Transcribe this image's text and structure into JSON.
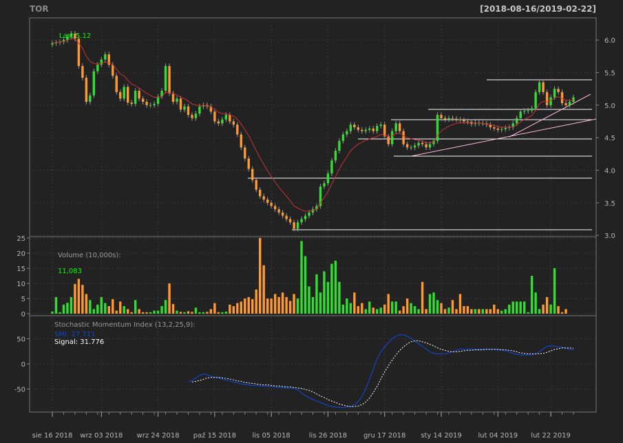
{
  "chart_data": {
    "type": "candlestick",
    "title": "TOR",
    "date_range": "[2018-08-16/2019-02-22]",
    "colors": {
      "background": "#222222",
      "grid": "#3a3a3a",
      "up": "#33dd33",
      "down": "#ff9933",
      "ma": "#cc3333",
      "smi": "#1144cc",
      "signal": "#ffffff",
      "level_line": "#ffffff",
      "trend_line": "#ffbbdd",
      "label_green": "#00ff00",
      "label_blue": "#1144cc"
    },
    "price_axis": {
      "ticks": [
        3.0,
        3.5,
        4.0,
        4.5,
        5.0,
        5.5,
        6.0
      ],
      "labels": [
        "3.0",
        "3.5",
        "4.0",
        "4.5",
        "5.0",
        "5.5",
        "6.0"
      ],
      "ylim": [
        2.98,
        6.34
      ]
    },
    "volume_axis": {
      "ticks": [
        0,
        5,
        10,
        15,
        20,
        25
      ],
      "labels": [
        "0",
        "5",
        "10",
        "15",
        "20",
        "25"
      ],
      "ylim": [
        0,
        25
      ]
    },
    "smi_axis": {
      "ticks": [
        -50,
        0,
        50
      ],
      "labels": [
        "-50",
        "0",
        "50"
      ],
      "ylim": [
        -96,
        96
      ]
    },
    "x_labels": [
      {
        "i": 0,
        "text": "sie 16 2018"
      },
      {
        "i": 13,
        "text": "wrz 03 2018"
      },
      {
        "i": 28,
        "text": "wrz 24 2018"
      },
      {
        "i": 43,
        "text": "paź 15 2018"
      },
      {
        "i": 58,
        "text": "lis 05 2018"
      },
      {
        "i": 73,
        "text": "lis 26 2018"
      },
      {
        "i": 88,
        "text": "gru 17 2018"
      },
      {
        "i": 103,
        "text": "sty 14 2019"
      },
      {
        "i": 118,
        "text": "lut 04 2019"
      },
      {
        "i": 132,
        "text": "lut 22 2019"
      }
    ],
    "last_label": "Last 5.12",
    "volume_label": "Volume (10,000s):",
    "volume_value": "11,083",
    "smi_label": "Stochastic Momentum Index (13,2,25,9):",
    "smi_value": "SMI: 27.711",
    "signal_value": "Signal: 31.776",
    "close": [
      5.95,
      5.96,
      5.97,
      6.0,
      6.05,
      6.1,
      6.02,
      5.6,
      5.42,
      5.05,
      5.15,
      5.52,
      5.62,
      5.7,
      5.78,
      5.62,
      5.45,
      5.2,
      5.1,
      5.28,
      5.04,
      5.02,
      5.22,
      5.1,
      5.05,
      5.0,
      5.0,
      5.02,
      5.13,
      5.22,
      5.6,
      5.18,
      5.05,
      5.1,
      4.93,
      4.98,
      4.85,
      4.8,
      4.87,
      4.98,
      5.0,
      4.98,
      4.9,
      4.75,
      4.72,
      4.78,
      4.85,
      4.75,
      4.7,
      4.55,
      4.35,
      4.18,
      4.02,
      3.85,
      3.7,
      3.6,
      3.55,
      3.5,
      3.45,
      3.4,
      3.35,
      3.3,
      3.25,
      3.2,
      3.1,
      3.2,
      3.25,
      3.3,
      3.35,
      3.4,
      3.45,
      3.75,
      3.8,
      3.95,
      4.15,
      4.3,
      4.45,
      4.55,
      4.6,
      4.7,
      4.66,
      4.62,
      4.6,
      4.62,
      4.64,
      4.6,
      4.68,
      4.7,
      4.52,
      4.4,
      4.6,
      4.72,
      4.6,
      4.4,
      4.35,
      4.35,
      4.38,
      4.42,
      4.4,
      4.35,
      4.4,
      4.45,
      4.85,
      4.8,
      4.78,
      4.8,
      4.79,
      4.78,
      4.77,
      4.75,
      4.74,
      4.71,
      4.73,
      4.72,
      4.72,
      4.7,
      4.66,
      4.64,
      4.62,
      4.63,
      4.65,
      4.66,
      4.72,
      4.8,
      4.9,
      4.91,
      4.92,
      4.95,
      5.2,
      5.35,
      5.2,
      5.0,
      5.12,
      5.25,
      5.2,
      5.03,
      5.0,
      5.05,
      5.12
    ],
    "ma": [
      5.95,
      5.96,
      5.97,
      5.98,
      6.0,
      6.02,
      6.02,
      5.95,
      5.87,
      5.75,
      5.67,
      5.64,
      5.63,
      5.64,
      5.66,
      5.65,
      5.62,
      5.55,
      5.48,
      5.45,
      5.38,
      5.32,
      5.3,
      5.26,
      5.22,
      5.18,
      5.15,
      5.12,
      5.12,
      5.13,
      5.2,
      5.19,
      5.17,
      5.16,
      5.12,
      5.1,
      5.06,
      5.02,
      5.0,
      4.99,
      4.99,
      4.99,
      4.97,
      4.93,
      4.89,
      4.87,
      4.87,
      4.85,
      4.83,
      4.78,
      4.71,
      4.62,
      4.53,
      4.42,
      4.3,
      4.19,
      4.09,
      3.99,
      3.9,
      3.82,
      3.74,
      3.67,
      3.6,
      3.53,
      3.45,
      3.42,
      3.39,
      3.37,
      3.37,
      3.38,
      3.4,
      3.5,
      3.58,
      3.67,
      3.79,
      3.9,
      4.02,
      4.12,
      4.21,
      4.3,
      4.35,
      4.4,
      4.43,
      4.46,
      4.48,
      4.5,
      4.52,
      4.55,
      4.54,
      4.52,
      4.53,
      4.56,
      4.57,
      4.53,
      4.5,
      4.48,
      4.47,
      4.46,
      4.45,
      4.42,
      4.42,
      4.43,
      4.54,
      4.6,
      4.64,
      4.68,
      4.7,
      4.72,
      4.73,
      4.73,
      4.73,
      4.72,
      4.72,
      4.72,
      4.72,
      4.71,
      4.7,
      4.69,
      4.67,
      4.66,
      4.66,
      4.66,
      4.67,
      4.7,
      4.74,
      4.78,
      4.81,
      4.84,
      4.92,
      5.02,
      5.06,
      5.05,
      5.07,
      5.11,
      5.13,
      5.1,
      5.08,
      5.07,
      5.08
    ],
    "volume": [
      0.7,
      5.5,
      0.5,
      3,
      3.6,
      5.5,
      9.8,
      11.5,
      9.5,
      6.5,
      4.5,
      1.5,
      3,
      5.5,
      3.5,
      2.5,
      4.8,
      1,
      4,
      2.5,
      1.5,
      0.5,
      4.5,
      1.5,
      0.5,
      0.5,
      0.5,
      1,
      1,
      2.5,
      4.5,
      10,
      3.2,
      1,
      0.6,
      0.5,
      0.8,
      0.6,
      2,
      0.5,
      0.5,
      0.6,
      1.5,
      3.5,
      0.5,
      0.5,
      0.7,
      3,
      2.5,
      3.5,
      4,
      5,
      5.5,
      4.8,
      8,
      25,
      16,
      5,
      5,
      6.5,
      5.5,
      7,
      5.5,
      4.2,
      6.5,
      5,
      24,
      19,
      9,
      5.5,
      13,
      7,
      14,
      10.5,
      16.5,
      17.5,
      10.5,
      3,
      5,
      3.5,
      7,
      2.5,
      3.5,
      1.5,
      4,
      2,
      1.5,
      2,
      3,
      6.5,
      4,
      4,
      1,
      2.5,
      5,
      3.5,
      2.5,
      1.5,
      10.5,
      1.5,
      6.5,
      7,
      4.5,
      3.5,
      1.5,
      2,
      4.5,
      1.5,
      6.5,
      2.5,
      2.5,
      1.5,
      1.5,
      1.5,
      1.5,
      1.5,
      1.5,
      3,
      1.5,
      1,
      1.5,
      3,
      4,
      4,
      4,
      4,
      0.5,
      12.5,
      7,
      1.5,
      3,
      5.5,
      3,
      15,
      2.5,
      0.5,
      1.5
    ],
    "smi": [
      -36,
      -33,
      -28,
      -23,
      -20,
      -22,
      -25,
      -27,
      -28,
      -30,
      -32,
      -34,
      -36,
      -38,
      -40,
      -41,
      -42,
      -43,
      -43,
      -44,
      -44,
      -45,
      -45,
      -46,
      -47,
      -47,
      -48,
      -48,
      -49,
      -52,
      -58,
      -63,
      -67,
      -71,
      -74,
      -77,
      -80,
      -83,
      -85,
      -86,
      -87,
      -87,
      -86,
      -85,
      -82,
      -75,
      -65,
      -50,
      -30,
      -10,
      10,
      24,
      34,
      42,
      50,
      55,
      58,
      58,
      55,
      51,
      45,
      40,
      35,
      30,
      24,
      21,
      20,
      20,
      20,
      22,
      24,
      27,
      30,
      29,
      29,
      29,
      29,
      29,
      29,
      29,
      29,
      29,
      28,
      28,
      26,
      24,
      21,
      19,
      18,
      18,
      18,
      18,
      20,
      24,
      30,
      35,
      36,
      35,
      34,
      33,
      31,
      29,
      28
    ],
    "signal": [
      -36,
      -35,
      -33,
      -31,
      -28,
      -27,
      -27,
      -27,
      -28,
      -29,
      -30,
      -32,
      -34,
      -35,
      -37,
      -38,
      -39,
      -40,
      -41,
      -42,
      -42,
      -43,
      -44,
      -44,
      -45,
      -46,
      -46,
      -47,
      -48,
      -49,
      -51,
      -53,
      -56,
      -60,
      -64,
      -67,
      -71,
      -74,
      -77,
      -80,
      -82,
      -84,
      -85,
      -85,
      -84,
      -81,
      -76,
      -68,
      -57,
      -45,
      -30,
      -16,
      -4,
      8,
      18,
      27,
      34,
      40,
      44,
      46,
      46,
      44,
      42,
      39,
      36,
      32,
      29,
      27,
      25,
      24,
      24,
      25,
      26,
      27,
      27,
      28,
      28,
      28,
      29,
      29,
      29,
      29,
      28,
      28,
      27,
      26,
      24,
      22,
      21,
      20,
      20,
      20,
      20,
      21,
      23,
      26,
      29,
      30,
      32,
      32,
      32,
      31
    ]
  }
}
